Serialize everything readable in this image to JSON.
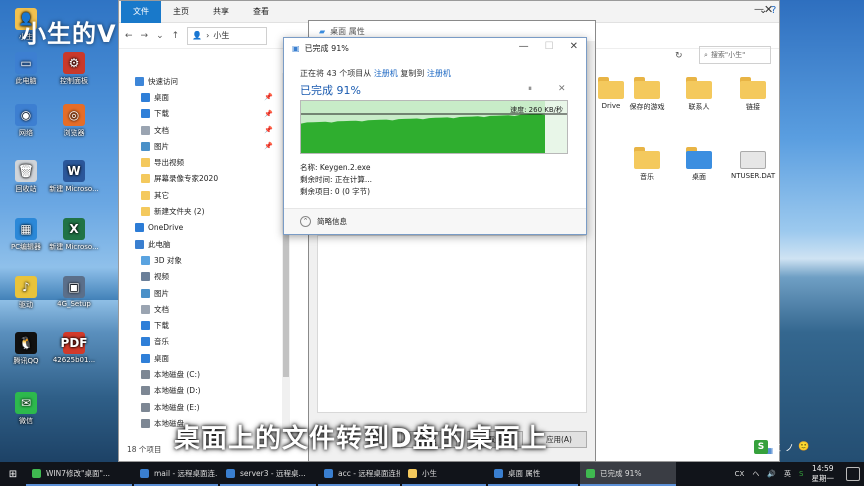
{
  "watermark": "小生的V",
  "desktop_icons": [
    {
      "label": "小生",
      "color": "#f2c14e",
      "glyph": "👤"
    },
    {
      "label": "此电脑",
      "color": "#3d7fd1",
      "glyph": "▭"
    },
    {
      "label": "网络",
      "color": "#3d7fd1",
      "glyph": "◉"
    },
    {
      "label": "回收站",
      "color": "#d0d4d9",
      "glyph": "🗑"
    },
    {
      "label": "PC编辑器",
      "color": "#2b88d8",
      "glyph": "▦"
    },
    {
      "label": "驱动",
      "color": "#e9c33b",
      "glyph": "♪"
    },
    {
      "label": "腾讯QQ",
      "color": "#111111",
      "glyph": "🐧"
    },
    {
      "label": "微信",
      "color": "#2db94d",
      "glyph": "✉"
    }
  ],
  "desktop_icons_col2": [
    {
      "label": "控制面板",
      "color": "#c9392b",
      "glyph": "⚙"
    },
    {
      "label": "浏览器",
      "color": "#e56d28",
      "glyph": "◎"
    },
    {
      "label": "新建 Microso...",
      "color": "#2b579a",
      "glyph": "W"
    },
    {
      "label": "新建 Microso...",
      "color": "#217346",
      "glyph": "X"
    },
    {
      "label": "4G_Setup",
      "color": "#5b6f8a",
      "glyph": "▣"
    },
    {
      "label": "42625b01...",
      "color": "#d23a2b",
      "glyph": "PDF"
    }
  ],
  "explorer": {
    "ribbon_tabs": [
      "文件",
      "主页",
      "共享",
      "查看"
    ],
    "path": "小生",
    "search_placeholder": "搜索\"小生\"",
    "status": "18 个项目",
    "nav_items": [
      {
        "label": "快速访问",
        "color": "#3d86d8",
        "lvl": 0,
        "pin": false
      },
      {
        "label": "桌面",
        "color": "#2f7fd8",
        "lvl": 1,
        "pin": true
      },
      {
        "label": "下载",
        "color": "#2f7fd8",
        "lvl": 1,
        "pin": true
      },
      {
        "label": "文档",
        "color": "#9aa4b1",
        "lvl": 1,
        "pin": true
      },
      {
        "label": "图片",
        "color": "#4a90c8",
        "lvl": 1,
        "pin": true
      },
      {
        "label": "导出视频",
        "color": "#f4c95d",
        "lvl": 1,
        "pin": false
      },
      {
        "label": "屏幕录像专家2020",
        "color": "#f4c95d",
        "lvl": 1,
        "pin": false
      },
      {
        "label": "其它",
        "color": "#f4c95d",
        "lvl": 1,
        "pin": false
      },
      {
        "label": "新建文件夹 (2)",
        "color": "#f4c95d",
        "lvl": 1,
        "pin": false
      },
      {
        "label": "OneDrive",
        "color": "#2c7cd6",
        "lvl": 0,
        "pin": false
      },
      {
        "label": "此电脑",
        "color": "#3a7fd0",
        "lvl": 0,
        "pin": false
      },
      {
        "label": "3D 对象",
        "color": "#5aa3e0",
        "lvl": 1,
        "pin": false
      },
      {
        "label": "视频",
        "color": "#6a7f99",
        "lvl": 1,
        "pin": false
      },
      {
        "label": "图片",
        "color": "#4a90c8",
        "lvl": 1,
        "pin": false
      },
      {
        "label": "文档",
        "color": "#9aa4b1",
        "lvl": 1,
        "pin": false
      },
      {
        "label": "下载",
        "color": "#2f7fd8",
        "lvl": 1,
        "pin": false
      },
      {
        "label": "音乐",
        "color": "#2f7fd8",
        "lvl": 1,
        "pin": false
      },
      {
        "label": "桌面",
        "color": "#2f7fd8",
        "lvl": 1,
        "pin": false
      },
      {
        "label": "本地磁盘 (C:)",
        "color": "#7d8794",
        "lvl": 1,
        "pin": false
      },
      {
        "label": "本地磁盘 (D:)",
        "color": "#7d8794",
        "lvl": 1,
        "pin": false
      },
      {
        "label": "本地磁盘 (E:)",
        "color": "#7d8794",
        "lvl": 1,
        "pin": false
      },
      {
        "label": "本地磁盘",
        "color": "#7d8794",
        "lvl": 1,
        "pin": false
      }
    ],
    "content_icons": [
      {
        "label": "Drive",
        "color": "#f4c95d",
        "sel": false
      },
      {
        "label": "保存的游戏",
        "color": "#f4c95d",
        "sel": false
      },
      {
        "label": "联系人",
        "color": "#f4c95d",
        "sel": false
      },
      {
        "label": "链接",
        "color": "#f4c95d",
        "sel": false
      },
      {
        "label": "音乐",
        "color": "#f4c95d",
        "sel": false
      },
      {
        "label": "桌面",
        "color": "#3b8ee0",
        "sel": true
      },
      {
        "label": "NTUSER.DAT",
        "color": "#e6e6e6",
        "sel": false
      }
    ]
  },
  "properties": {
    "title": "桌面 属性",
    "ok": "确定",
    "cancel": "取消",
    "apply": "应用(A)"
  },
  "progress": {
    "title": "已完成 91%",
    "copy_prefix": "正在将 43 个项目从",
    "src": "注册机",
    "mid": "复制到",
    "dst": "注册机",
    "percent_label": "已完成 91%",
    "speed": "速度: 260 KB/秒",
    "name_line": "名称: Keygen.2.exe",
    "time_line": "剩余时间: 正在计算...",
    "items_line": "剩余项目: 0 (0 字节)",
    "details": "简略信息",
    "progress_value": 91
  },
  "subtitle": "桌面上的文件转到D盘的桌面上",
  "ime": {
    "badge": "S",
    "labels": [
      "五",
      "ノ",
      "🙂"
    ]
  },
  "taskbar": {
    "items": [
      {
        "label": "WIN7修改\"桌面\"...",
        "color": "#3fb950",
        "active": false
      },
      {
        "label": "mail - 远程桌面连...",
        "color": "#3a7fd0",
        "active": false
      },
      {
        "label": "server3 - 远程桌...",
        "color": "#3a7fd0",
        "active": false
      },
      {
        "label": "acc - 远程桌面连接",
        "color": "#3a7fd0",
        "active": false
      },
      {
        "label": "小生",
        "color": "#f4c95d",
        "active": false
      },
      {
        "label": "桌面 属性",
        "color": "#3a7fd0",
        "active": false
      },
      {
        "label": "已完成 91%",
        "color": "#3fb950",
        "active": true
      }
    ],
    "tray": [
      "CX",
      "ヘ",
      "英"
    ],
    "time": "14:59",
    "weekday": "星期一"
  }
}
